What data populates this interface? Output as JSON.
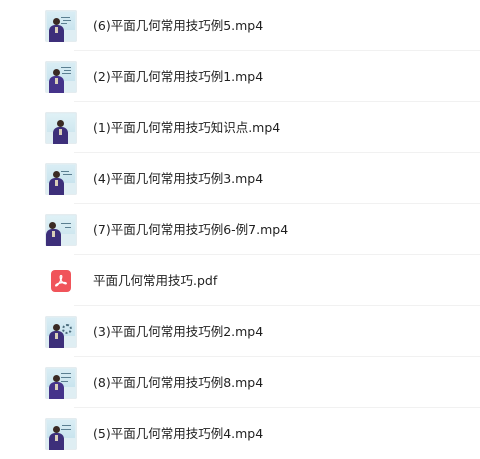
{
  "files": [
    {
      "name": "(6)平面几何常用技巧例5.mp4",
      "icon": "video-thumbnail-icon"
    },
    {
      "name": "(2)平面几何常用技巧例1.mp4",
      "icon": "video-thumbnail-icon"
    },
    {
      "name": "(1)平面几何常用技巧知识点.mp4",
      "icon": "video-thumbnail-icon"
    },
    {
      "name": "(4)平面几何常用技巧例3.mp4",
      "icon": "video-thumbnail-icon"
    },
    {
      "name": "(7)平面几何常用技巧例6-例7.mp4",
      "icon": "video-thumbnail-icon"
    },
    {
      "name": "平面几何常用技巧.pdf",
      "icon": "pdf-file-icon"
    },
    {
      "name": "(3)平面几何常用技巧例2.mp4",
      "icon": "video-thumbnail-icon"
    },
    {
      "name": "(8)平面几何常用技巧例8.mp4",
      "icon": "video-thumbnail-icon"
    },
    {
      "name": "(5)平面几何常用技巧例4.mp4",
      "icon": "video-thumbnail-icon"
    }
  ],
  "colors": {
    "pdf_icon": "#f0545a",
    "text": "#1f1f1f",
    "divider": "#f1f1f1"
  }
}
